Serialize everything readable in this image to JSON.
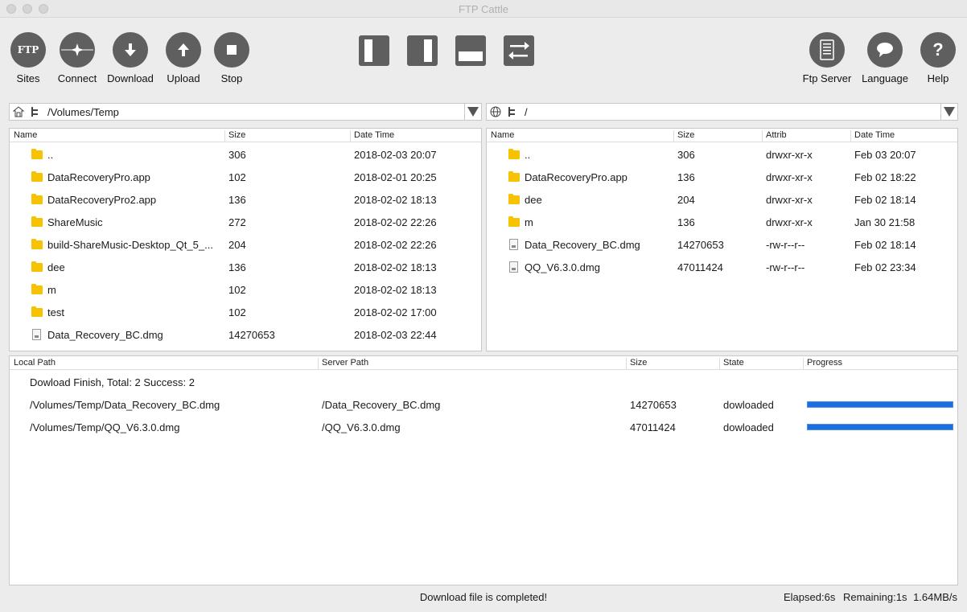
{
  "window": {
    "title": "FTP Cattle"
  },
  "toolbar": {
    "sites": "Sites",
    "connect": "Connect",
    "download": "Download",
    "upload": "Upload",
    "stop": "Stop",
    "ftp_badge": "FTP",
    "ftp_server": "Ftp Server",
    "language": "Language",
    "help": "Help",
    "help_glyph": "?"
  },
  "local": {
    "path": "/Volumes/Temp",
    "columns": [
      "Name",
      "Size",
      "Date Time"
    ],
    "rows": [
      {
        "name": "..",
        "size": "306",
        "date": "2018-02-03 20:07",
        "type": "folder"
      },
      {
        "name": "DataRecoveryPro.app",
        "size": "102",
        "date": "2018-02-01 20:25",
        "type": "folder"
      },
      {
        "name": "DataRecoveryPro2.app",
        "size": "136",
        "date": "2018-02-02 18:13",
        "type": "folder"
      },
      {
        "name": "ShareMusic",
        "size": "272",
        "date": "2018-02-02 22:26",
        "type": "folder"
      },
      {
        "name": "build-ShareMusic-Desktop_Qt_5_...",
        "size": "204",
        "date": "2018-02-02 22:26",
        "type": "folder"
      },
      {
        "name": "dee",
        "size": "136",
        "date": "2018-02-02 18:13",
        "type": "folder"
      },
      {
        "name": "m",
        "size": "102",
        "date": "2018-02-02 18:13",
        "type": "folder"
      },
      {
        "name": "test",
        "size": "102",
        "date": "2018-02-02 17:00",
        "type": "folder"
      },
      {
        "name": "Data_Recovery_BC.dmg",
        "size": "14270653",
        "date": "2018-02-03 22:44",
        "type": "file"
      }
    ]
  },
  "remote": {
    "path": "/",
    "columns": [
      "Name",
      "Size",
      "Attrib",
      "Date Time"
    ],
    "rows": [
      {
        "name": "..",
        "size": "306",
        "attrib": "drwxr-xr-x",
        "date": "Feb 03 20:07",
        "type": "folder"
      },
      {
        "name": "DataRecoveryPro.app",
        "size": "136",
        "attrib": "drwxr-xr-x",
        "date": "Feb 02 18:22",
        "type": "folder"
      },
      {
        "name": "dee",
        "size": "204",
        "attrib": "drwxr-xr-x",
        "date": "Feb 02 18:14",
        "type": "folder"
      },
      {
        "name": "m",
        "size": "136",
        "attrib": "drwxr-xr-x",
        "date": "Jan 30 21:58",
        "type": "folder"
      },
      {
        "name": "Data_Recovery_BC.dmg",
        "size": "14270653",
        "attrib": "-rw-r--r--",
        "date": "Feb 02 18:14",
        "type": "file"
      },
      {
        "name": "QQ_V6.3.0.dmg",
        "size": "47011424",
        "attrib": "-rw-r--r--",
        "date": "Feb 02 23:34",
        "type": "file"
      }
    ]
  },
  "transfers": {
    "columns": [
      "Local Path",
      "Server Path",
      "Size",
      "State",
      "Progress"
    ],
    "summary": "Dowload Finish, Total: 2 Success: 2",
    "rows": [
      {
        "local": "/Volumes/Temp/Data_Recovery_BC.dmg",
        "server": "/Data_Recovery_BC.dmg",
        "size": "14270653",
        "state": "dowloaded",
        "progress": 1.0
      },
      {
        "local": "/Volumes/Temp/QQ_V6.3.0.dmg",
        "server": "/QQ_V6.3.0.dmg",
        "size": "47011424",
        "state": "dowloaded",
        "progress": 1.0
      }
    ]
  },
  "status": {
    "message": "Download file is completed!",
    "elapsed": "Elapsed:6s",
    "remaining": "Remaining:1s",
    "speed": "1.64MB/s"
  },
  "colors": {
    "accent": "#1a6ee0",
    "folder": "#f7c300",
    "icon": "#5f5f5f"
  }
}
